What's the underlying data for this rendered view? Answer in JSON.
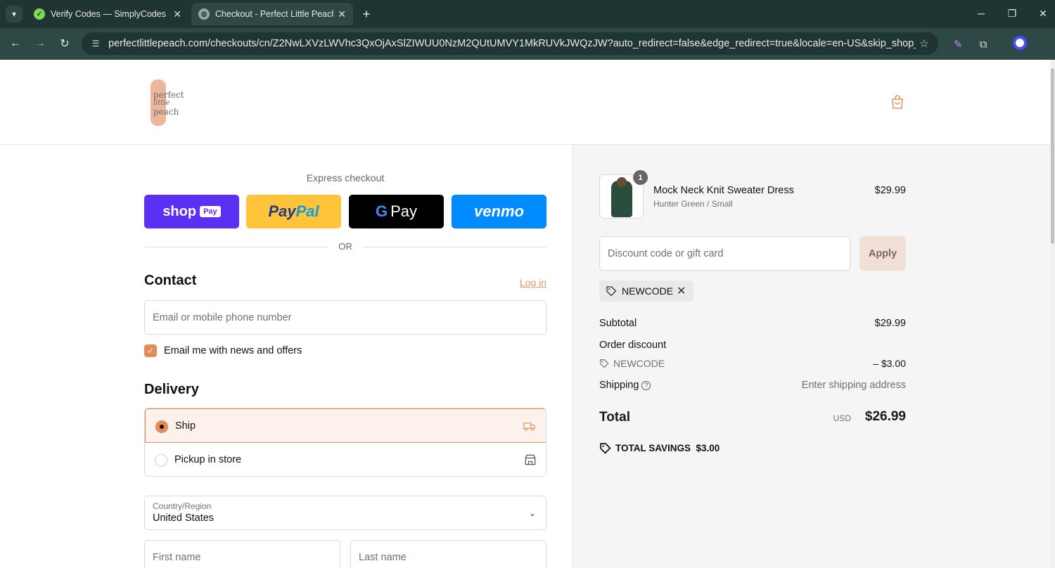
{
  "browser": {
    "tabs": [
      {
        "title": "Verify Codes — SimplyCodes",
        "active": false
      },
      {
        "title": "Checkout - Perfect Little Peach",
        "active": true
      }
    ],
    "url": "perfectlittlepeach.com/checkouts/cn/Z2NwLXVzLWVhc3QxOjAxSlZIWUU0NzM2QUtUMVY1MkRUVkJWQzJW?auto_redirect=false&edge_redirect=true&locale=en-US&skip_shop_pay=true",
    "icons": {
      "tab_menu": "chevron-down-icon",
      "back": "back-arrow-icon",
      "forward": "forward-arrow-icon",
      "reload": "reload-icon",
      "site_info": "site-info-icon",
      "bookmark": "star-icon",
      "extension": "puzzle-icon"
    }
  },
  "header": {
    "logo_words": [
      "perfect",
      "little",
      "peach"
    ],
    "accent": "#e59661"
  },
  "express": {
    "label": "Express checkout",
    "buttons": {
      "shop": "shop",
      "shop_chip": "Pay",
      "paypal_a": "Pay",
      "paypal_b": "Pal",
      "gpay_g": "G",
      "gpay": "Pay",
      "venmo": "venmo"
    },
    "or": "OR"
  },
  "contact": {
    "title": "Contact",
    "login": "Log in",
    "email_placeholder": "Email or mobile phone number",
    "newsletter_label": "Email me with news and offers",
    "newsletter_checked": true
  },
  "delivery": {
    "title": "Delivery",
    "options": [
      {
        "label": "Ship",
        "selected": true,
        "icon": "truck-icon"
      },
      {
        "label": "Pickup in store",
        "selected": false,
        "icon": "store-icon"
      }
    ],
    "country_label": "Country/Region",
    "country_value": "United States",
    "first_name_placeholder": "First name",
    "last_name_placeholder": "Last name"
  },
  "summary": {
    "item": {
      "name": "Mock Neck Knit Sweater Dress",
      "variant": "Hunter Green / Small",
      "price": "$29.99",
      "quantity": "1"
    },
    "discount_placeholder": "Discount code or gift card",
    "apply": "Apply",
    "applied_code": "NEWCODE",
    "subtotal_label": "Subtotal",
    "subtotal": "$29.99",
    "order_discount_label": "Order discount",
    "discount_code": "NEWCODE",
    "discount_amount": "– $3.00",
    "shipping_label": "Shipping",
    "shipping_value": "Enter shipping address",
    "total_label": "Total",
    "currency": "USD",
    "total": "$26.99",
    "savings_label": "TOTAL SAVINGS",
    "savings_value": "$3.00"
  }
}
